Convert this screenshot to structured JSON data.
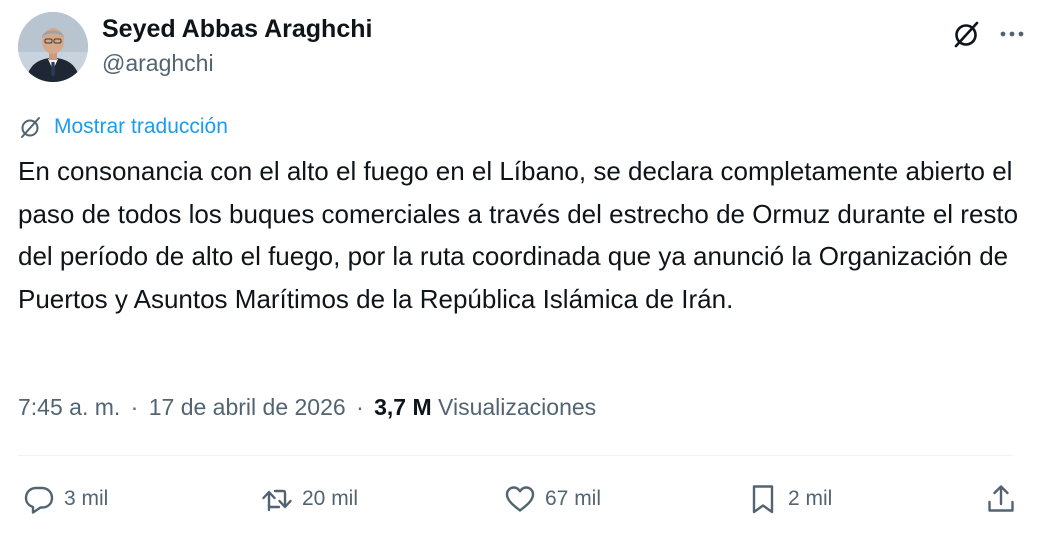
{
  "author": {
    "display_name": "Seyed Abbas Araghchi",
    "handle": "@araghchi"
  },
  "top_actions": {
    "grok_icon": "grok-slash-icon",
    "more_icon": "more-horizontal-icon"
  },
  "translate": {
    "label": "Mostrar traducción",
    "icon": "grok-slash-icon"
  },
  "tweet": {
    "text": "En consonancia con el alto el fuego en el Líbano, se declara completamente abierto el paso de todos los buques comerciales a través del estrecho de Ormuz durante el resto del período de alto el fuego, por la ruta coordinada que ya anunció la Organización de Puertos y Asuntos Marítimos de la República Islámica de Irán."
  },
  "meta": {
    "time": "7:45 a. m.",
    "separator": "·",
    "date": "17 de abril de 2026",
    "views_count": "3,7 M",
    "views_label": "Visualizaciones"
  },
  "actions": {
    "reply": {
      "count": "3 mil",
      "icon": "reply-icon"
    },
    "repost": {
      "count": "20 mil",
      "icon": "repost-icon"
    },
    "like": {
      "count": "67 mil",
      "icon": "heart-icon"
    },
    "bookmark": {
      "count": "2 mil",
      "icon": "bookmark-icon"
    },
    "share": {
      "icon": "share-icon"
    }
  },
  "colors": {
    "accent": "#1d9bf0",
    "text_primary": "#0f1419",
    "text_secondary": "#536471",
    "divider": "#eff3f4"
  }
}
